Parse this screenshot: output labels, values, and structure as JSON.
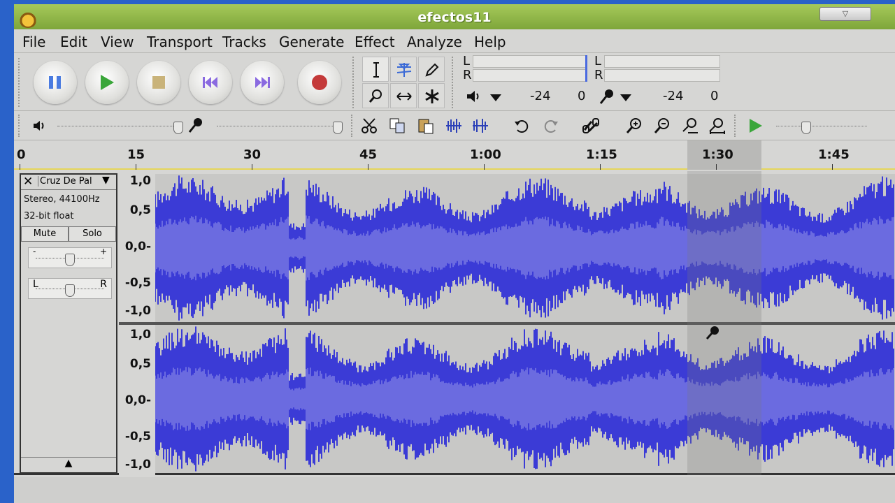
{
  "window": {
    "title": "efectos11"
  },
  "menu": [
    {
      "label": "File"
    },
    {
      "label": "Edit"
    },
    {
      "label": "View"
    },
    {
      "label": "Transport"
    },
    {
      "label": "Tracks"
    },
    {
      "label": "Generate"
    },
    {
      "label": "Effect"
    },
    {
      "label": "Analyze"
    },
    {
      "label": "Help"
    }
  ],
  "transport": {
    "buttons": [
      "pause",
      "play",
      "stop",
      "skip-start",
      "skip-end",
      "record"
    ]
  },
  "meters": {
    "left_label": "L",
    "right_label": "R",
    "playback_db": "-24",
    "playback_zero": "0",
    "record_db": "-24",
    "record_zero": "0"
  },
  "ruler": {
    "ticks": [
      "0",
      "15",
      "30",
      "45",
      "1:00",
      "1:15",
      "1:30",
      "1:45"
    ]
  },
  "track": {
    "name": "Cruz De Pal",
    "info_rate": "Stereo, 44100Hz",
    "info_format": "32-bit float",
    "mute_label": "Mute",
    "solo_label": "Solo",
    "gain_minus": "-",
    "gain_plus": "+",
    "pan_left": "L",
    "pan_right": "R",
    "vscale": [
      "1,0",
      "0,5",
      "0,0-",
      "-0,5",
      "-1,0"
    ]
  },
  "colors": {
    "waveform": "#3b3bd6",
    "waveform_rms": "#6b6be0",
    "selection": "#b9b9b7",
    "title_bar": "#8fb44a"
  }
}
